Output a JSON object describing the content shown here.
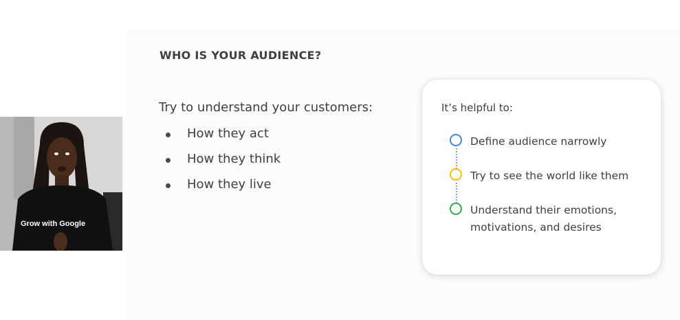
{
  "slide": {
    "title": "WHO IS YOUR AUDIENCE?",
    "intro": "Try to understand your customers:",
    "bullets": [
      "How they act",
      "How they think",
      "How they live"
    ]
  },
  "card": {
    "heading": "It’s helpful to:",
    "steps": [
      {
        "label_lines": [
          "Define audience narrowly"
        ],
        "color": "#4285f4"
      },
      {
        "label_lines": [
          "Try to see the world like them"
        ],
        "color": "#fbbc04"
      },
      {
        "label_lines": [
          "Understand their emotions,",
          "motivations, and desires"
        ],
        "color": "#34a853"
      }
    ]
  },
  "presenter": {
    "shirt_text": "Grow with Google"
  }
}
